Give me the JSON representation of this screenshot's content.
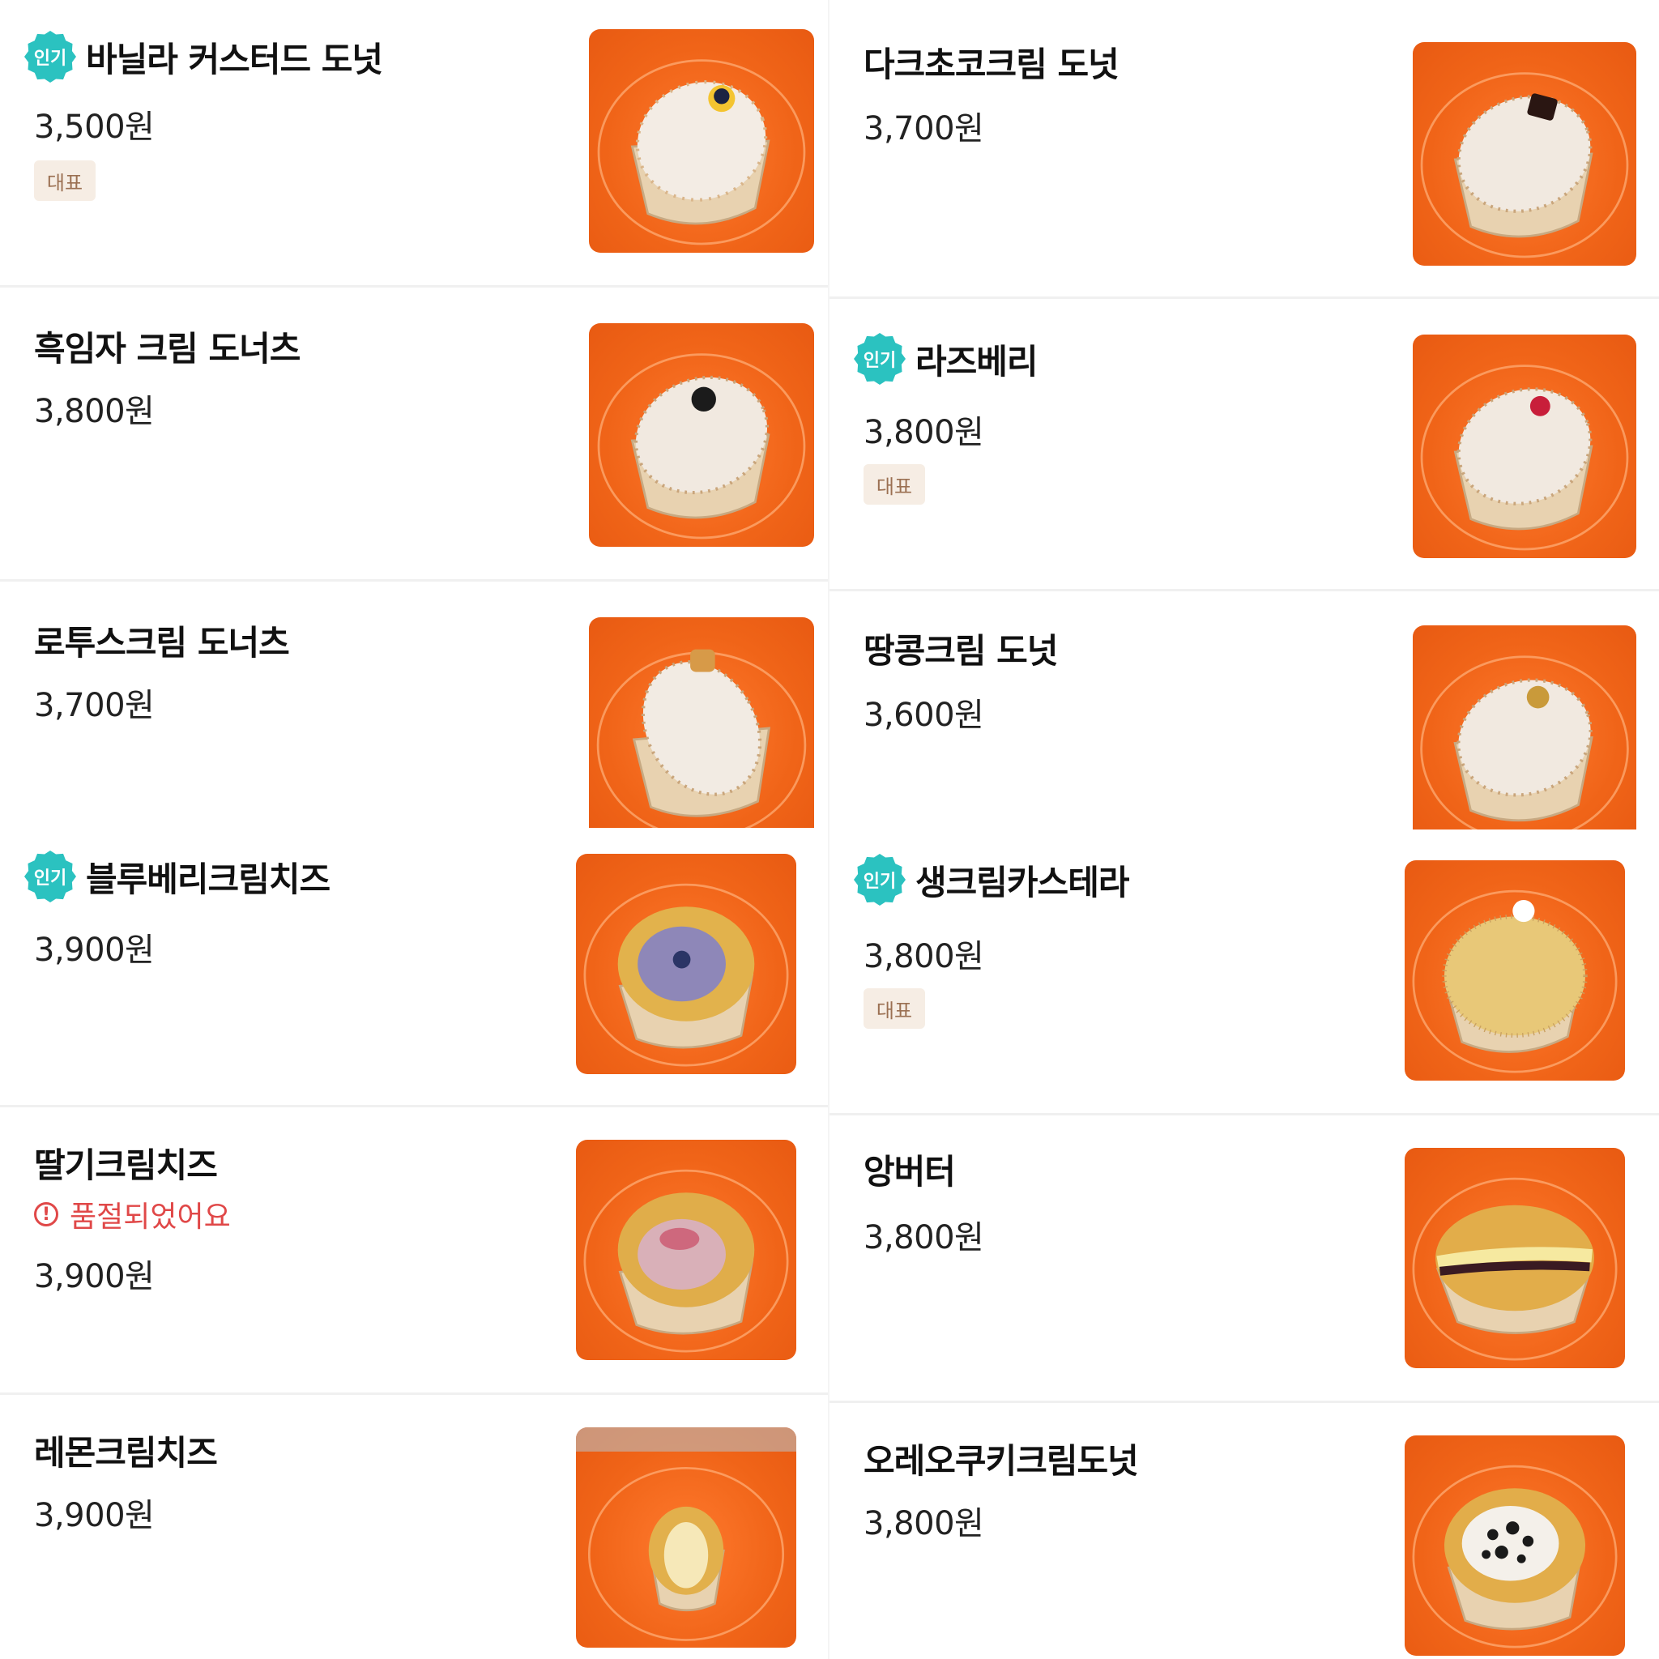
{
  "labels": {
    "popular": "인기",
    "representative": "대표",
    "warning_glyph": "!"
  },
  "menu": {
    "left": [
      {
        "name": "바닐라 커스터드 도넛",
        "price": "3,500원",
        "popular": true,
        "representative": true,
        "photo_icon": "donut-vanilla-custard"
      },
      {
        "name": "흑임자 크림 도너츠",
        "price": "3,800원",
        "popular": false,
        "representative": false,
        "photo_icon": "donut-black-sesame"
      },
      {
        "name": "로투스크림 도너츠",
        "price": "3,700원",
        "popular": false,
        "representative": false,
        "photo_icon": "donut-lotus"
      },
      {
        "name": "블루베리크림치즈",
        "price": "3,900원",
        "popular": true,
        "representative": false,
        "photo_icon": "bun-blueberry-cream-cheese"
      },
      {
        "name": "딸기크림치즈",
        "price": "3,900원",
        "popular": false,
        "representative": false,
        "sold_out_text": "품절되었어요",
        "photo_icon": "bun-strawberry-cream-cheese"
      },
      {
        "name": "레몬크림치즈",
        "price": "3,900원",
        "popular": false,
        "representative": false,
        "photo_icon": "bun-lemon-cream-cheese"
      }
    ],
    "right": [
      {
        "name": "다크초코크림 도넛",
        "price": "3,700원",
        "popular": false,
        "representative": false,
        "photo_icon": "donut-dark-choco"
      },
      {
        "name": "라즈베리",
        "price": "3,800원",
        "popular": true,
        "representative": true,
        "photo_icon": "donut-raspberry"
      },
      {
        "name": "땅콩크림 도넛",
        "price": "3,600원",
        "popular": false,
        "representative": false,
        "photo_icon": "donut-peanut"
      },
      {
        "name": "생크림카스테라",
        "price": "3,800원",
        "popular": true,
        "representative": true,
        "photo_icon": "donut-cream-castella"
      },
      {
        "name": "앙버터",
        "price": "3,800원",
        "popular": false,
        "representative": false,
        "photo_icon": "bun-red-bean-butter"
      },
      {
        "name": "오레오쿠키크림도넛",
        "price": "3,800원",
        "popular": false,
        "representative": false,
        "photo_icon": "bun-oreo-cream"
      }
    ]
  },
  "colors": {
    "popular_badge": "#2bc2c0",
    "sold_out": "#e04848",
    "rep_bg": "#f6ede4",
    "rep_text": "#9b7052",
    "tray": "#f06418"
  }
}
